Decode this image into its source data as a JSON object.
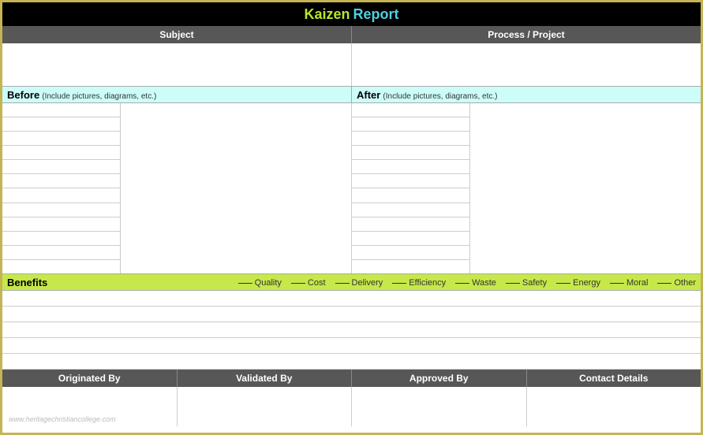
{
  "title": {
    "kaizen": "Kaizen",
    "report": "Report"
  },
  "headers": {
    "subject": "Subject",
    "process": "Process / Project"
  },
  "before": {
    "label": "Before",
    "note": "(Include pictures, diagrams, etc.)"
  },
  "after": {
    "label": "After",
    "note": "(Include pictures, diagrams, etc.)"
  },
  "list_rows": 12,
  "benefits": {
    "label": "Benefits",
    "options": [
      "Quality",
      "Cost",
      "Delivery",
      "Efficiency",
      "Waste",
      "Safety",
      "Energy",
      "Moral",
      "Other"
    ]
  },
  "benefits_rows": 5,
  "footer": {
    "originated": "Originated By",
    "validated": "Validated By",
    "approved": "Approved By",
    "contact": "Contact Details"
  },
  "watermark": "www.heritagechristiancollege.com"
}
